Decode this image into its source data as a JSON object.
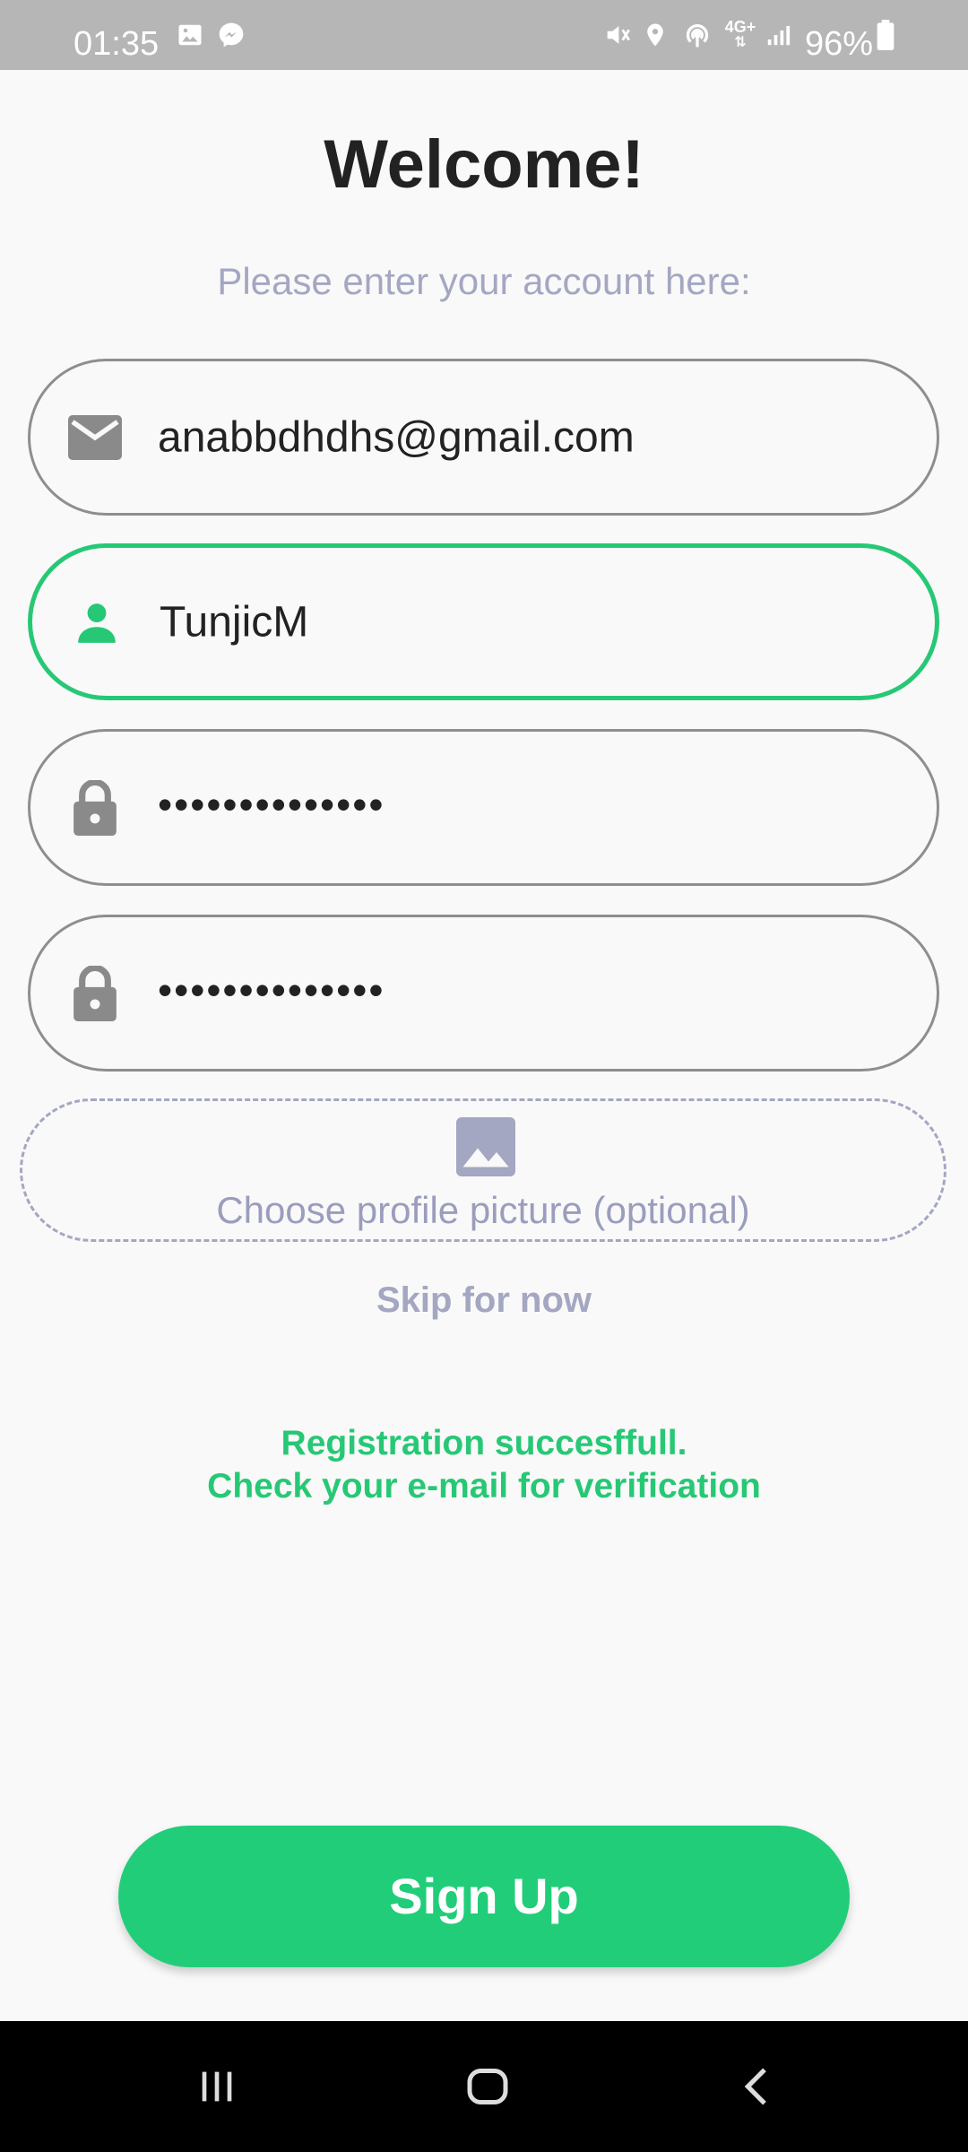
{
  "status_bar": {
    "time": "01:35",
    "battery": "96%",
    "icons": [
      "gallery-icon",
      "messenger-icon",
      "mute-icon",
      "location-icon",
      "hotspot-icon",
      "4g-icon",
      "signal-icon",
      "battery-icon"
    ]
  },
  "header": {
    "title": "Welcome!",
    "subtitle": "Please enter your account here:"
  },
  "form": {
    "email": {
      "value": "anabbdhdhs@gmail.com",
      "icon": "mail-icon"
    },
    "username": {
      "value": "TunjicM",
      "icon": "person-icon",
      "focused": true
    },
    "password": {
      "value": "••••••••••••••",
      "icon": "lock-icon"
    },
    "confirm_password": {
      "value": "••••••••••••••",
      "icon": "lock-icon"
    },
    "profile_picture": {
      "label": "Choose profile picture (optional)",
      "icon": "image-icon"
    },
    "skip_label": "Skip for now"
  },
  "message": {
    "line1": "Registration succesffull.",
    "line2": "Check your e-mail for verification"
  },
  "signup_label": "Sign Up",
  "colors": {
    "accent": "#21cd79",
    "muted": "#a4a7c2",
    "border": "#8e8e8e",
    "background": "#f9f9f9"
  },
  "nav_bar": {
    "buttons": [
      "recent-apps-icon",
      "home-icon",
      "back-icon"
    ]
  }
}
